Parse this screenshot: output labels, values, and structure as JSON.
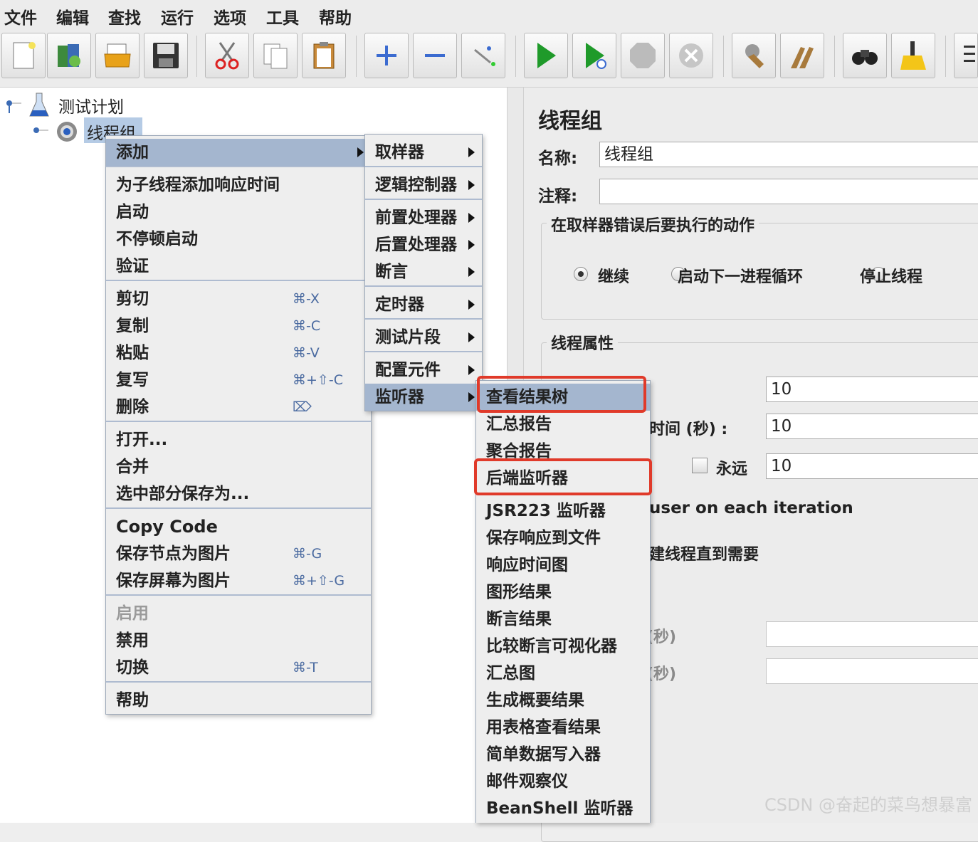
{
  "menubar": {
    "items": [
      "文件",
      "编辑",
      "查找",
      "运行",
      "选项",
      "工具",
      "帮助"
    ]
  },
  "toolbar": {
    "icons": [
      "new-icon",
      "templates-icon",
      "open-icon",
      "save-icon",
      "cut-icon",
      "copy-icon",
      "paste-icon",
      "expand-icon",
      "collapse-icon",
      "toggle-icon",
      "start-icon",
      "start-no-pause-icon",
      "stop-icon",
      "shutdown-icon",
      "clear-icon",
      "clear-all-icon",
      "search-icon",
      "reset-search-icon",
      "function-helper-icon"
    ]
  },
  "tree": {
    "root": "测试计划",
    "child": "线程组"
  },
  "panel": {
    "title": "线程组",
    "name_label": "名称:",
    "name_value": "线程组",
    "comment_label": "注释:",
    "comment_value": "",
    "error_group_title": "在取样器错误后要执行的动作",
    "error_options": [
      "继续",
      "启动下一进程循环",
      "停止线程"
    ],
    "error_selected": "继续",
    "thread_group_title": "线程属性",
    "threads_value": "10",
    "ramp_label": "时间 (秒) :",
    "ramp_value": "10",
    "loop_forever_label": "永远",
    "loop_value": "10",
    "same_user_text": "user on each iteration",
    "delay_text": "建线程直到需要",
    "duration_text": "(秒)",
    "startup_delay_text": "(秒)",
    "duration_value": "",
    "startup_delay_value": ""
  },
  "context_menu": {
    "add": "添加",
    "group1": [
      "为子线程添加响应时间",
      "启动",
      "不停顿启动",
      "验证"
    ],
    "edit": [
      {
        "label": "剪切",
        "shortcut": "⌘-X"
      },
      {
        "label": "复制",
        "shortcut": "⌘-C"
      },
      {
        "label": "粘贴",
        "shortcut": "⌘-V"
      },
      {
        "label": "复写",
        "shortcut": "⌘+⇧-C"
      },
      {
        "label": "删除",
        "shortcut": "⌦"
      }
    ],
    "file": [
      "打开...",
      "合并",
      "选中部分保存为..."
    ],
    "copy_code": "Copy Code",
    "save_node_img": {
      "label": "保存节点为图片",
      "shortcut": "⌘-G"
    },
    "save_screen_img": {
      "label": "保存屏幕为图片",
      "shortcut": "⌘+⇧-G"
    },
    "enable": "启用",
    "disable": "禁用",
    "toggle": {
      "label": "切换",
      "shortcut": "⌘-T"
    },
    "help": "帮助"
  },
  "add_submenu": [
    "取样器",
    "逻辑控制器",
    "前置处理器",
    "后置处理器",
    "断言",
    "定时器",
    "测试片段",
    "配置元件",
    "监听器"
  ],
  "listener_submenu": [
    "查看结果树",
    "汇总报告",
    "聚合报告",
    "后端监听器",
    "JSR223 监听器",
    "保存响应到文件",
    "响应时间图",
    "图形结果",
    "断言结果",
    "比较断言可视化器",
    "汇总图",
    "生成概要结果",
    "用表格查看结果",
    "简单数据写入器",
    "邮件观察仪",
    "BeanShell 监听器"
  ],
  "watermark": "CSDN @奋起的菜鸟想暴富"
}
